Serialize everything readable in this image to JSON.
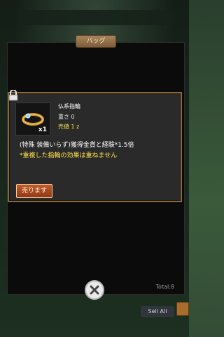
{
  "bag": {
    "title": "バッグ",
    "total_label": "Total:8"
  },
  "item": {
    "name": "仏系指輪",
    "weight": "重さ 0",
    "price": "売値 1 z",
    "count": "x1",
    "description": "(特殊 装備いらず)獲得金貨と経験*1.5倍",
    "note": "*重複した指輪の効果は重ねません"
  },
  "buttons": {
    "sell": "売ります",
    "sell_all": "Sell All"
  },
  "colors": {
    "accent_yellow": "#ffe24a",
    "panel_border": "#8a6a3d",
    "sell_button": "#b24f23"
  }
}
